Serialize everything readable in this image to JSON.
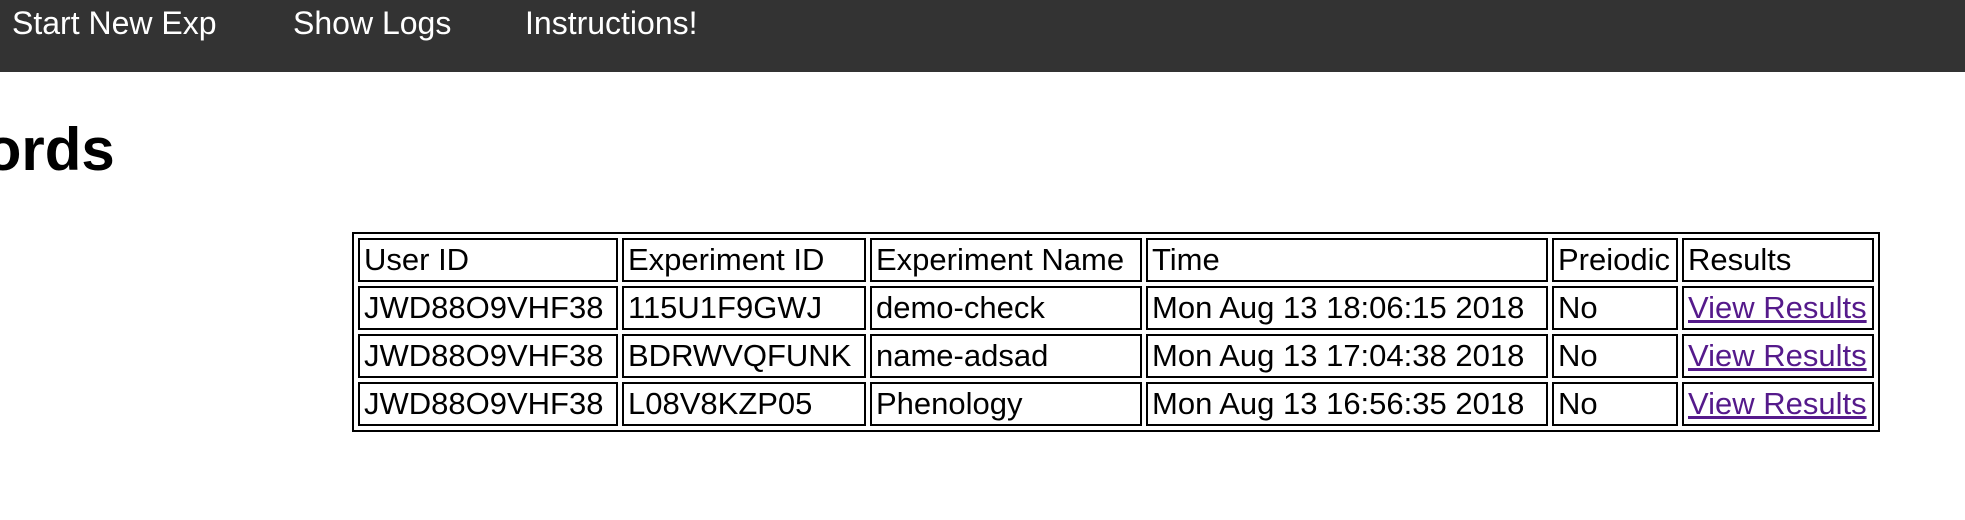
{
  "nav": {
    "items": [
      {
        "label": "Start New Exp"
      },
      {
        "label": "Show Logs"
      },
      {
        "label": "Instructions!"
      }
    ]
  },
  "page": {
    "title": "ecords"
  },
  "table": {
    "headers": [
      "User ID",
      "Experiment ID",
      "Experiment Name",
      "Time",
      "Preiodic",
      "Results"
    ],
    "rows": [
      {
        "user_id": "JWD88O9VHF38",
        "experiment_id": "115U1F9GWJ",
        "experiment_name": "demo-check",
        "time": "Mon Aug 13 18:06:15 2018",
        "periodic": "No",
        "results": "View Results"
      },
      {
        "user_id": "JWD88O9VHF38",
        "experiment_id": "BDRWVQFUNK",
        "experiment_name": "name-adsad",
        "time": "Mon Aug 13 17:04:38 2018",
        "periodic": "No",
        "results": "View Results"
      },
      {
        "user_id": "JWD88O9VHF38",
        "experiment_id": "L08V8KZP05",
        "experiment_name": "Phenology",
        "time": "Mon Aug 13 16:56:35 2018",
        "periodic": "No",
        "results": "View Results"
      }
    ]
  },
  "colors": {
    "navbar_bg": "#333333",
    "nav_text": "#ffffff",
    "visited_link": "#551a8b"
  }
}
